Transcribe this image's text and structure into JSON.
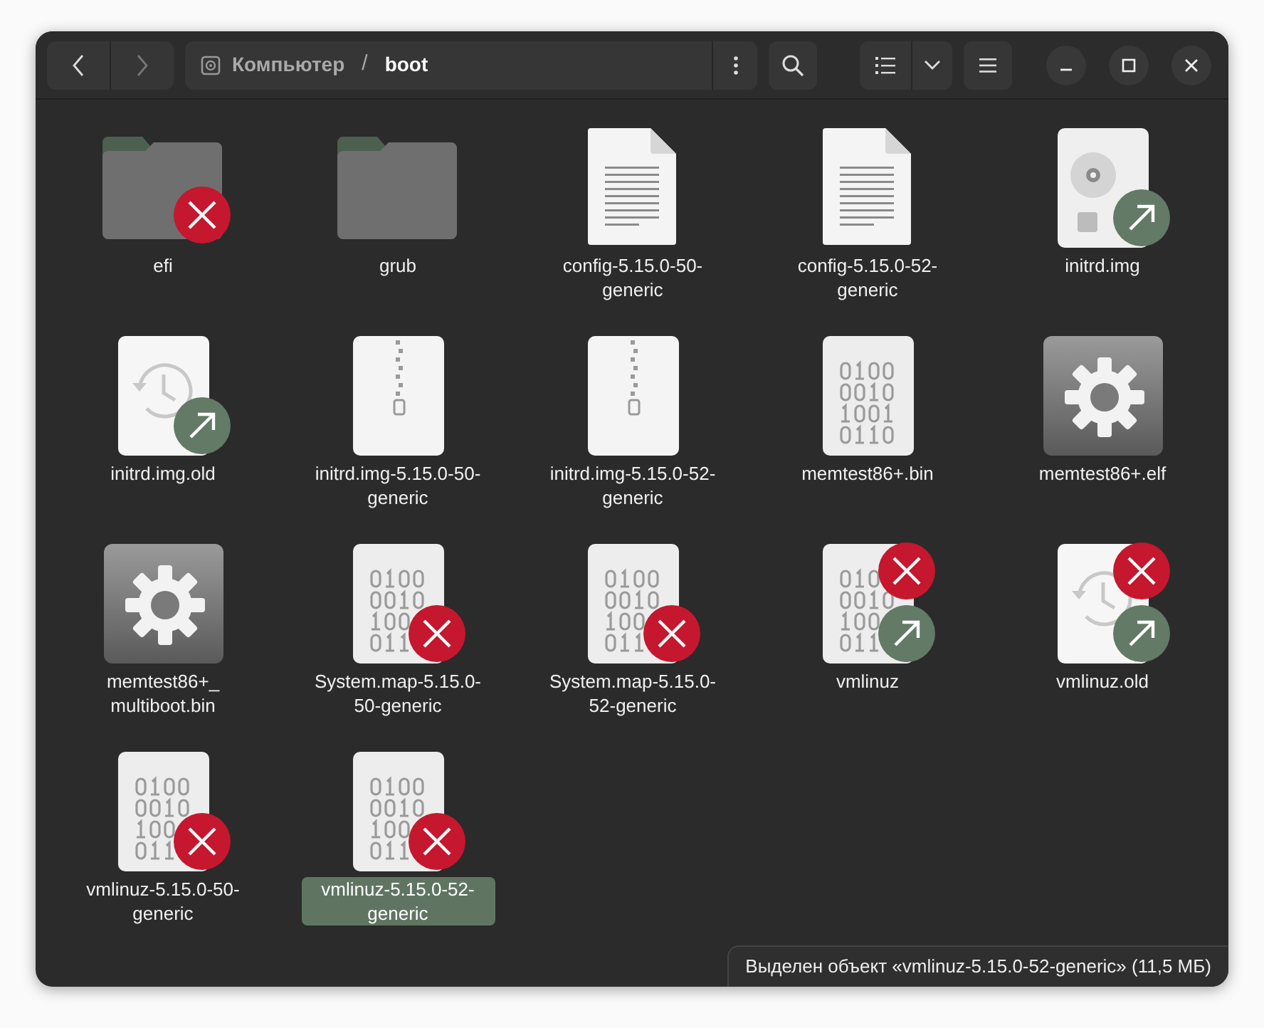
{
  "navigation": {
    "back_disabled": false,
    "forward_disabled": true
  },
  "path": [
    {
      "label": "Компьютер",
      "current": false
    },
    {
      "label": "boot",
      "current": true
    }
  ],
  "path_separator": "/",
  "files": [
    {
      "name": "efi",
      "kind": "folder",
      "broken": true,
      "link": false,
      "selected": false
    },
    {
      "name": "grub",
      "kind": "folder",
      "broken": false,
      "link": false,
      "selected": false
    },
    {
      "name": "config-5.15.0-50-generic",
      "kind": "text",
      "broken": false,
      "link": false,
      "selected": false
    },
    {
      "name": "config-5.15.0-52-generic",
      "kind": "text",
      "broken": false,
      "link": false,
      "selected": false
    },
    {
      "name": "initrd.img",
      "kind": "disc",
      "broken": false,
      "link": true,
      "selected": false
    },
    {
      "name": "initrd.img.old",
      "kind": "history",
      "broken": false,
      "link": true,
      "selected": false
    },
    {
      "name": "initrd.img-5.15.0-50-generic",
      "kind": "archive",
      "broken": false,
      "link": false,
      "selected": false
    },
    {
      "name": "initrd.img-5.15.0-52-generic",
      "kind": "archive",
      "broken": false,
      "link": false,
      "selected": false
    },
    {
      "name": "memtest86+.bin",
      "kind": "binary",
      "broken": false,
      "link": false,
      "selected": false
    },
    {
      "name": "memtest86+.elf",
      "kind": "executable",
      "broken": false,
      "link": false,
      "selected": false
    },
    {
      "name": "memtest86+_multiboot.bin",
      "kind": "executable",
      "broken": false,
      "link": false,
      "selected": false
    },
    {
      "name": "System.map-5.15.0-50-generic",
      "kind": "binary",
      "broken": true,
      "link": false,
      "selected": false
    },
    {
      "name": "System.map-5.15.0-52-generic",
      "kind": "binary",
      "broken": true,
      "link": false,
      "selected": false
    },
    {
      "name": "vmlinuz",
      "kind": "binary",
      "broken": true,
      "link": true,
      "selected": false
    },
    {
      "name": "vmlinuz.old",
      "kind": "history",
      "broken": true,
      "link": true,
      "selected": false
    },
    {
      "name": "vmlinuz-5.15.0-50-generic",
      "kind": "binary",
      "broken": true,
      "link": false,
      "selected": false
    },
    {
      "name": "vmlinuz-5.15.0-52-generic",
      "kind": "binary",
      "broken": true,
      "link": false,
      "selected": true
    }
  ],
  "status": "Выделен объект «vmlinuz-5.15.0-52-generic» (11,5 МБ)"
}
